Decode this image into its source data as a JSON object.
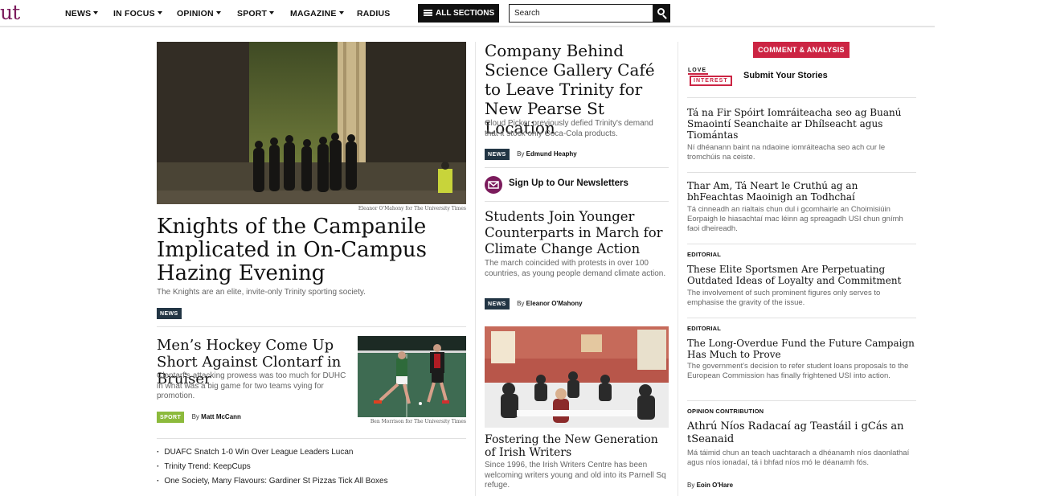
{
  "brand": {
    "logo_text": "ut"
  },
  "nav": {
    "items": [
      {
        "label": "NEWS",
        "dropdown": true
      },
      {
        "label": "IN FOCUS",
        "dropdown": true
      },
      {
        "label": "OPINION",
        "dropdown": true
      },
      {
        "label": "SPORT",
        "dropdown": true
      },
      {
        "label": "MAGAZINE",
        "dropdown": true
      },
      {
        "label": "RADIUS",
        "dropdown": false
      }
    ],
    "all_sections": "ALL SECTIONS",
    "search_placeholder": "Search"
  },
  "colors": {
    "brand": "#7b1b5c",
    "news_tag": "#223544",
    "sport_tag": "#8cba3c",
    "comment": "#cc2443"
  },
  "lead": {
    "photo_credit": "Eleanor O'Mahony for The University Times",
    "title": "Knights of the Campanile Implicated in On-Campus Hazing Evening",
    "dek": "The Knights are an elite, invite-only Trinity sporting society.",
    "tag": "NEWS"
  },
  "hockey": {
    "title": "Men’s Hockey Come Up Short Against Clontarf in Bruiser",
    "dek": "Clontarf's attacking prowess was too much for DUHC in what was a big game for two teams vying for promotion.",
    "tag": "SPORT",
    "by": "By",
    "author": "Matt McCann",
    "photo_credit": "Ben Morrison for The University Times"
  },
  "more_links": [
    "DUAFC Snatch 1-0 Win Over League Leaders Lucan",
    "Trinity Trend: KeepCups",
    "One Society, Many Flavours: Gardiner St Pizzas Tick All Boxes"
  ],
  "middle": {
    "science_gallery": {
      "title": "Company Behind Science Gallery Café to Leave Trinity for New Pearse St Location",
      "dek": "Cloud Picker previously defied Trinity's demand that it stock only Coca-Cola products.",
      "tag": "NEWS",
      "by": "By",
      "author": "Edmund Heaphy"
    },
    "newsletter": "Sign Up to Our Newsletters",
    "climate": {
      "title": "Students Join Younger Counterparts in March for Climate Change Action",
      "dek": "The march coincided with protests in over 100 countries, as young people demand climate action.",
      "tag": "NEWS",
      "by": "By",
      "author": "Eleanor O'Mahony"
    },
    "writers": {
      "title": "Fostering the New Generation of Irish Writers",
      "dek": "Since 1996, the Irish Writers Centre has been welcoming writers young and old into its Parnell Sq refuge."
    }
  },
  "comment": {
    "label": "COMMENT & ANALYSIS",
    "love_line1": "LOVE",
    "love_line2": "INTEREST",
    "submit": "Submit Your Stories",
    "items": [
      {
        "section": "",
        "title": "Tá na Fir Spóirt Iomráiteacha seo ag Buanú Smaointí Seanchaite ar Dhílseacht agus Tiomántas",
        "dek": "Ní dhéanann baint na ndaoine iomráiteacha seo ach cur le tromchúis na ceiste."
      },
      {
        "section": "",
        "title": "Thar Am, Tá Neart le Cruthú ag an bhFeachtas Maoinigh an Todhchaí",
        "dek": "Tá cinneadh an rialtais chun dul i gcomhairle an Choimisiúin Eorpaigh le hiasachtaí mac léinn ag spreagadh USI chun gnímh faoi dheireadh."
      },
      {
        "section": "EDITORIAL",
        "title": "These Elite Sportsmen Are Perpetuating Outdated Ideas of Loyalty and Commitment",
        "dek": "The involvement of such prominent figures only serves to emphasise the gravity of the issue."
      },
      {
        "section": "EDITORIAL",
        "title": "The Long-Overdue Fund the Future Campaign Has Much to Prove",
        "dek": "The government's decision to refer student loans proposals to the European Commission has finally frightened USI into action."
      },
      {
        "section": "OPINION CONTRIBUTION",
        "title": "Athrú Níos Radacaí ag Teastáil i gCás an tSeanaid",
        "dek": "Má táimid chun an teach uachtarach a dhéanamh níos daonlathaí agus níos ionadaí, tá i bhfad níos mó le déanamh fós.",
        "by": "By",
        "author": "Eoin O'Hare"
      }
    ]
  }
}
